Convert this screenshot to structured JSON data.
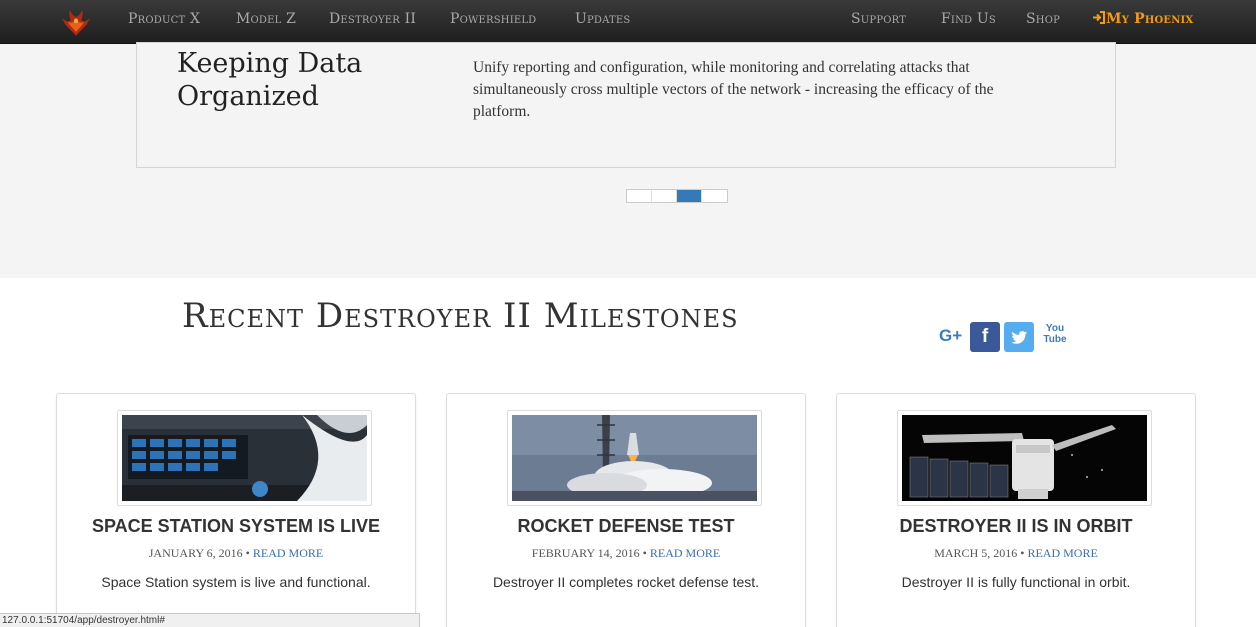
{
  "nav": {
    "logo_icon": "phoenix-logo-icon",
    "left_items": [
      "Product X",
      "Model Z",
      "Destroyer II",
      "Powershield",
      "Updates"
    ],
    "right_items": [
      "Support",
      "Find Us",
      "Shop"
    ],
    "account": {
      "icon": "sign-in-icon",
      "label": "My Phoenix",
      "color": "#f39c12"
    }
  },
  "slider": {
    "title": "Keeping Data Organized",
    "text": "Unify reporting and configuration, while monitoring and correlating attacks that simultaneously cross multiple vectors of the network - increasing the efficacy of the platform.",
    "indicator_count": 4,
    "active_index": 2,
    "active_color": "#337ab7"
  },
  "milestones": {
    "title": "Recent Destroyer II Milestones",
    "social": [
      {
        "icon": "google-plus-icon",
        "label": "G+"
      },
      {
        "icon": "facebook-icon",
        "label": "f"
      },
      {
        "icon": "twitter-icon"
      },
      {
        "icon": "youtube-icon",
        "label": "You Tube"
      }
    ],
    "cards": [
      {
        "image": "space-station-interior-image",
        "title": "SPACE STATION SYSTEM IS LIVE",
        "date": "JANUARY 6, 2016",
        "read_more": "READ MORE",
        "text": "Space Station system is live and functional."
      },
      {
        "image": "rocket-launch-image",
        "title": "ROCKET DEFENSE TEST",
        "date": "FEBRUARY 14, 2016",
        "read_more": "READ MORE",
        "text": "Destroyer II completes rocket defense test."
      },
      {
        "image": "satellite-in-orbit-image",
        "title": "DESTROYER II IS IN ORBIT",
        "date": "MARCH 5, 2016",
        "read_more": "READ MORE",
        "text": "Destroyer II is fully functional in orbit."
      }
    ]
  },
  "status_bar": "127.0.0.1:51704/app/destroyer.html#"
}
